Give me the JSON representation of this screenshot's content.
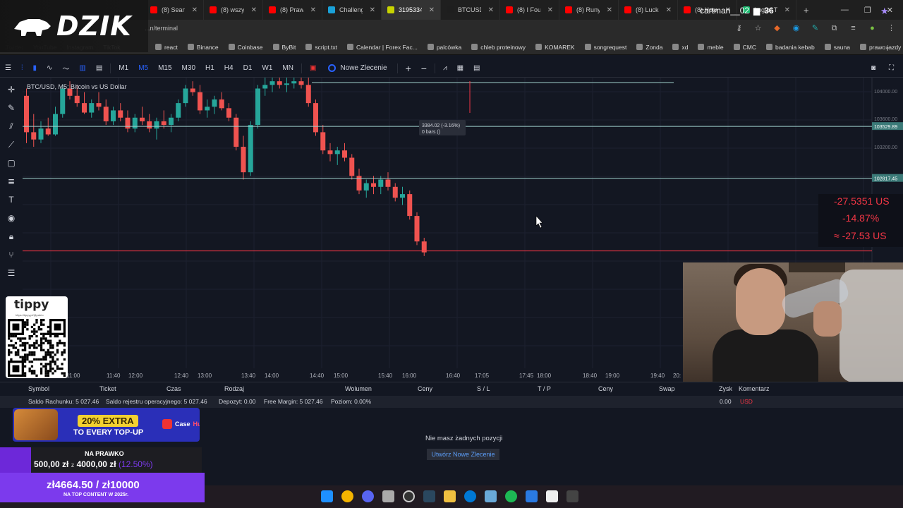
{
  "browser": {
    "tabs": [
      {
        "label": "(8) Sean P...",
        "color": "#ff0000"
      },
      {
        "label": "(8) wszyst...",
        "color": "#ff0000"
      },
      {
        "label": "(8) Prawdz...",
        "color": "#ff0000"
      },
      {
        "label": "Challenge",
        "color": "#1aa1d8"
      },
      {
        "label": "31953344",
        "color": "#c8d400",
        "active": true
      },
      {
        "label": "BTCUSD T...",
        "color": "#1e1e1e"
      },
      {
        "label": "(8) I Found",
        "color": "#ff0000"
      },
      {
        "label": "(8) Runy s...",
        "color": "#ff0000"
      },
      {
        "label": "(8) Lucksh...",
        "color": "#ff0000"
      },
      {
        "label": "(8) How T...",
        "color": "#ff0000"
      },
      {
        "label": "Imgur: The",
        "color": "#1bb76e"
      }
    ],
    "new_tab": "+",
    "url": "...n/terminal",
    "bookmarks_faded": [
      "Twitter",
      "YouTube",
      "Instagram",
      "TikTok"
    ],
    "bookmarks": [
      "react",
      "Binance",
      "Coinbase",
      "ByBit",
      "script.txt",
      "Calendar | Forex Fac...",
      "palcówka",
      "chleb proteinowy",
      "KOMAREK",
      "songrequest",
      "Zonda",
      "xd",
      "meble",
      "CMC",
      "badania kebab",
      "sauna",
      "prawo jazdy"
    ],
    "bookmarks_more": "»"
  },
  "overlay": {
    "logo": "DZIK"
  },
  "toolbar": {
    "timeframes": [
      "M1",
      "M5",
      "M15",
      "M30",
      "H1",
      "H4",
      "D1",
      "W1",
      "MN"
    ],
    "active_timeframe": "M5",
    "new_order": "Nowe Zlecenie",
    "plus": "+",
    "minus": "−"
  },
  "chart": {
    "title": "BTC/USD, M5: Bitcoin vs US Dollar",
    "tooltip_line1": "3384.02 (-3.16%)",
    "tooltip_line2": "0 bars ()",
    "price_ticks": [
      "104000.00",
      "103600.00",
      "103200.00"
    ],
    "price_labels": [
      {
        "value": "103529.89",
        "color": "#3b7a78"
      },
      {
        "value": "102817.45",
        "color": "#3b7a78"
      }
    ],
    "pnl_lines": [
      "-27.5351 US",
      "-14.87%",
      "≈ -27.53 US"
    ],
    "time_labels": [
      "11:00",
      "11:40",
      "12:00",
      "12:40",
      "13:00",
      "13:40",
      "14:00",
      "14:40",
      "15:00",
      "15:40",
      "16:00",
      "16:40",
      "17:05",
      "17:45",
      "18:00",
      "18:40",
      "19:00",
      "19:40",
      "20:"
    ],
    "chart_data": {
      "type": "candlestick",
      "symbol": "BTC/USD",
      "timeframe": "M5",
      "x_start": "11:00",
      "x_end": "20:00",
      "candles": [
        {
          "o": 103950,
          "h": 104050,
          "l": 103300,
          "c": 103450
        },
        {
          "o": 103450,
          "h": 103700,
          "l": 103250,
          "c": 103350
        },
        {
          "o": 103350,
          "h": 103600,
          "l": 103300,
          "c": 103500
        },
        {
          "o": 103500,
          "h": 103650,
          "l": 103400,
          "c": 103420
        },
        {
          "o": 103420,
          "h": 103800,
          "l": 103400,
          "c": 103700
        },
        {
          "o": 103700,
          "h": 104100,
          "l": 103650,
          "c": 104050
        },
        {
          "o": 104050,
          "h": 104150,
          "l": 103900,
          "c": 103950
        },
        {
          "o": 103950,
          "h": 104100,
          "l": 103800,
          "c": 103850
        },
        {
          "o": 103850,
          "h": 104000,
          "l": 103700,
          "c": 103720
        },
        {
          "o": 103720,
          "h": 103900,
          "l": 103650,
          "c": 103850
        },
        {
          "o": 103850,
          "h": 104000,
          "l": 103750,
          "c": 103800
        },
        {
          "o": 103800,
          "h": 103900,
          "l": 103550,
          "c": 103600
        },
        {
          "o": 103600,
          "h": 103800,
          "l": 103550,
          "c": 103750
        },
        {
          "o": 103750,
          "h": 103850,
          "l": 103600,
          "c": 103650
        },
        {
          "o": 103650,
          "h": 103750,
          "l": 103450,
          "c": 103500
        },
        {
          "o": 103500,
          "h": 103700,
          "l": 103450,
          "c": 103650
        },
        {
          "o": 103650,
          "h": 103800,
          "l": 103550,
          "c": 103600
        },
        {
          "o": 103600,
          "h": 103700,
          "l": 103450,
          "c": 103500
        },
        {
          "o": 103500,
          "h": 103650,
          "l": 103350,
          "c": 103600
        },
        {
          "o": 103600,
          "h": 103750,
          "l": 103500,
          "c": 103550
        },
        {
          "o": 103550,
          "h": 103700,
          "l": 103450,
          "c": 103650
        },
        {
          "o": 103650,
          "h": 103900,
          "l": 103600,
          "c": 103850
        },
        {
          "o": 103850,
          "h": 104100,
          "l": 103800,
          "c": 104050
        },
        {
          "o": 104050,
          "h": 104150,
          "l": 103950,
          "c": 104000
        },
        {
          "o": 104000,
          "h": 104100,
          "l": 103700,
          "c": 103750
        },
        {
          "o": 103750,
          "h": 103900,
          "l": 103650,
          "c": 103800
        },
        {
          "o": 103800,
          "h": 103950,
          "l": 103700,
          "c": 103900
        },
        {
          "o": 103900,
          "h": 104000,
          "l": 103750,
          "c": 103780
        },
        {
          "o": 103780,
          "h": 103850,
          "l": 103600,
          "c": 103650
        },
        {
          "o": 103650,
          "h": 103700,
          "l": 103200,
          "c": 103250
        },
        {
          "o": 103250,
          "h": 103400,
          "l": 102800,
          "c": 102900
        },
        {
          "o": 102900,
          "h": 103600,
          "l": 102850,
          "c": 103550
        },
        {
          "o": 103550,
          "h": 104100,
          "l": 103500,
          "c": 104050
        },
        {
          "o": 104050,
          "h": 104200,
          "l": 103950,
          "c": 104100
        },
        {
          "o": 104100,
          "h": 104200,
          "l": 104000,
          "c": 104150
        },
        {
          "o": 104150,
          "h": 104250,
          "l": 104050,
          "c": 104100
        },
        {
          "o": 104100,
          "h": 104200,
          "l": 104000,
          "c": 104120
        },
        {
          "o": 104120,
          "h": 104200,
          "l": 104050,
          "c": 104150
        },
        {
          "o": 104150,
          "h": 104250,
          "l": 104050,
          "c": 104100
        },
        {
          "o": 104100,
          "h": 104200,
          "l": 103800,
          "c": 103850
        },
        {
          "o": 103850,
          "h": 103900,
          "l": 103400,
          "c": 103450
        },
        {
          "o": 103450,
          "h": 103550,
          "l": 103150,
          "c": 103200
        },
        {
          "o": 103200,
          "h": 103300,
          "l": 103050,
          "c": 103150
        },
        {
          "o": 103150,
          "h": 103250,
          "l": 103000,
          "c": 103200
        },
        {
          "o": 103200,
          "h": 103300,
          "l": 103050,
          "c": 103100
        },
        {
          "o": 103100,
          "h": 103150,
          "l": 102800,
          "c": 102850
        },
        {
          "o": 102850,
          "h": 102950,
          "l": 102600,
          "c": 102650
        },
        {
          "o": 102650,
          "h": 102800,
          "l": 102550,
          "c": 102750
        },
        {
          "o": 102750,
          "h": 102850,
          "l": 102600,
          "c": 102700
        },
        {
          "o": 102700,
          "h": 102850,
          "l": 102600,
          "c": 102800
        },
        {
          "o": 102800,
          "h": 102900,
          "l": 102650,
          "c": 102700
        },
        {
          "o": 102700,
          "h": 102750,
          "l": 102500,
          "c": 102550
        },
        {
          "o": 102550,
          "h": 102700,
          "l": 102450,
          "c": 102600
        },
        {
          "o": 102600,
          "h": 102650,
          "l": 102250,
          "c": 102300
        },
        {
          "o": 102300,
          "h": 102350,
          "l": 101900,
          "c": 101950
        },
        {
          "o": 101950,
          "h": 102000,
          "l": 101750,
          "c": 101800
        }
      ],
      "horizontal_lines": [
        103529.89,
        102817.45
      ],
      "y_ticks": [
        104000,
        103600,
        103200
      ],
      "ylim": [
        101700,
        104200
      ]
    }
  },
  "positions": {
    "columns": [
      "Symbol",
      "Ticket",
      "Czas",
      "Rodzaj",
      "Wolumen",
      "Ceny",
      "S / L",
      "T / P",
      "Ceny",
      "Swap",
      "Zysk",
      "Komentarz"
    ],
    "balance": {
      "account": "Saldo Rachunku: 5 027.46",
      "operational": "Saldo rejestru operacyjnego: 5 027.46",
      "deposit": "Depozyt: 0.00",
      "free_margin": "Free Margin: 5 027.46",
      "level": "Poziom: 0.00%",
      "profit": "0.00",
      "currency": "USD"
    },
    "empty_message": "Nie masz żadnych pozycji",
    "create_order": "Utwórz Nowe Zlecenie"
  },
  "widgets": {
    "tippy_title": "tippy",
    "tippy_sub": "https://tippy.pl/@patrio",
    "promo_big": "20% EXTRA",
    "promo_small": "TO EVERY TOP-UP",
    "promo_brand": "Case",
    "promo_brand2": "Hug",
    "goal1_label": "NA PRAWKO",
    "goal1_current": "500,00 zł",
    "goal1_sep": "z",
    "goal1_target": "4000,00 zł",
    "goal1_pct": "(12.50%)",
    "goal2_value": "zł4664.50 / zł10000",
    "goal2_sub": "NA TOP CONTENT W 2025r."
  },
  "taskbar": {
    "username": "cartman__02",
    "count": "36"
  }
}
